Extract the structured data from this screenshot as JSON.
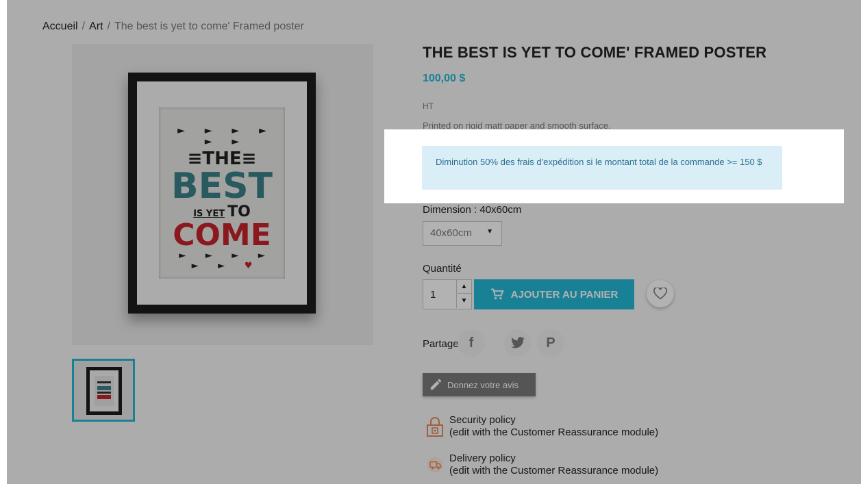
{
  "breadcrumb": {
    "items": [
      "Accueil",
      "Art"
    ],
    "current": "The best is yet to come' Framed poster",
    "separator": "/"
  },
  "product": {
    "title": "THE BEST IS YET TO COME' FRAMED POSTER",
    "price": "100,00 $",
    "tax_label": "HT",
    "short_description": "Printed on rigid matt paper and smooth surface."
  },
  "artwork": {
    "arrows_top": "► ► ► ► ► ►",
    "line1": "≡THE≡",
    "line2": "BEST",
    "line3_small": "IS YET",
    "line3_big": "TO",
    "line4": "COME",
    "arrows_bottom": "► ► ► ► ► ►",
    "heart": "♥"
  },
  "promo": {
    "message": "Diminution 50% des frais d'expédition si le montant total de la commande >= 150 $"
  },
  "variant": {
    "label": "Dimension : 40x60cm",
    "selected": "40x60cm"
  },
  "quantity": {
    "label": "Quantité",
    "value": "1"
  },
  "actions": {
    "add_to_cart": "AJOUTER AU PANIER",
    "share_label": "Partager",
    "review": "Donnez votre avis"
  },
  "social": {
    "facebook": "f",
    "twitter": "twitter-icon",
    "pinterest": "P"
  },
  "reassurance": [
    {
      "icon": "lock-icon",
      "title": "Security policy",
      "subtitle": "(edit with the Customer Reassurance module)"
    },
    {
      "icon": "truck-icon",
      "title": "Delivery policy",
      "subtitle": "(edit with the Customer Reassurance module)"
    }
  ],
  "colors": {
    "accent": "#24b9d7",
    "alert_bg": "#d9eef7",
    "alert_text": "#2b6f90",
    "best_teal": "#3c8288",
    "come_red": "#c8232c"
  }
}
